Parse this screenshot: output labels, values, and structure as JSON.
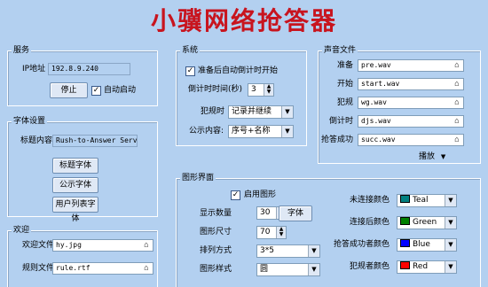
{
  "app_title": "小骥网络抢答器",
  "service": {
    "title": "服务",
    "ip_label": "IP地址",
    "ip_value": "192.8.9.240",
    "stop_button": "停止",
    "autostart_label": "自动启动",
    "autostart_checked": true
  },
  "font": {
    "title": "字体设置",
    "caption_label": "标题内容",
    "caption_value": "Rush-to-Answer Server",
    "title_font_button": "标题字体",
    "notice_font_button": "公示字体",
    "user_list_font_button": "用户列表字体"
  },
  "welcome": {
    "title": "欢迎",
    "welcome_file_label": "欢迎文件",
    "welcome_file_value": "hy.jpg",
    "rules_file_label": "规则文件",
    "rules_file_value": "rule.rtf"
  },
  "system": {
    "title": "系统",
    "auto_countdown_label": "准备后自动倒计时开始",
    "auto_countdown_checked": true,
    "countdown_label": "倒计时时间(秒)",
    "countdown_value": "3",
    "foul_label": "犯规时",
    "foul_value": "记录并继续",
    "notice_label": "公示内容:",
    "notice_value": "序号+名称"
  },
  "sound": {
    "title": "声音文件",
    "rows": [
      {
        "label": "准备",
        "value": "pre.wav"
      },
      {
        "label": "开始",
        "value": "start.wav"
      },
      {
        "label": "犯规",
        "value": "wg.wav"
      },
      {
        "label": "倒计时",
        "value": "djs.wav"
      },
      {
        "label": "抢答成功",
        "value": "succ.wav"
      }
    ],
    "play_label": "播放"
  },
  "graphics": {
    "title": "图形界面",
    "enable_label": "启用图形",
    "enable_checked": true,
    "display_count_label": "显示数量",
    "display_count_value": "30",
    "font_button": "字体",
    "size_label": "图形尺寸",
    "size_value": "70",
    "layout_label": "排列方式",
    "layout_value": "3*5",
    "style_label": "图形样式",
    "style_value": "圆",
    "colors": [
      {
        "label": "未连接颜色",
        "name": "Teal",
        "hex": "#008080"
      },
      {
        "label": "连接后颜色",
        "name": "Green",
        "hex": "#008000"
      },
      {
        "label": "抢答成功者颜色",
        "name": "Blue",
        "hex": "#0000ff"
      },
      {
        "label": "犯规者颜色",
        "name": "Red",
        "hex": "#ff0000"
      }
    ]
  }
}
